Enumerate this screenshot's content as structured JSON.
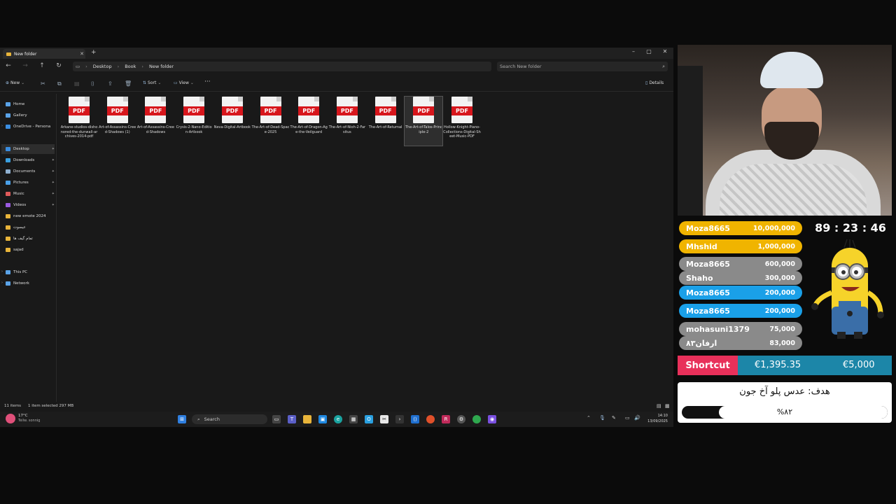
{
  "explorer": {
    "tab_title": "New folder",
    "breadcrumb": [
      "Desktop",
      "Book",
      "New folder"
    ],
    "search_placeholder": "Search New folder",
    "commands": {
      "new": "New",
      "sort": "Sort",
      "view": "View",
      "details": "Details"
    },
    "sidebar": [
      {
        "label": "Home",
        "color": "#5aa3e8"
      },
      {
        "label": "Gallery",
        "color": "#5aa3e8"
      },
      {
        "label": "OneDrive - Persona",
        "color": "#3a8de0"
      },
      {
        "label": "Desktop",
        "color": "#3a8de0",
        "pinned": true,
        "selected": true
      },
      {
        "label": "Downloads",
        "color": "#3aa0e0",
        "pinned": true
      },
      {
        "label": "Documents",
        "color": "#8fb0d0",
        "pinned": true
      },
      {
        "label": "Pictures",
        "color": "#4aa0e8",
        "pinned": true
      },
      {
        "label": "Music",
        "color": "#e05a5a",
        "pinned": true
      },
      {
        "label": "Videos",
        "color": "#9a5ae0",
        "pinned": true
      },
      {
        "label": "new emote 2024",
        "color": "#e8b43a"
      },
      {
        "label": "عیسوت",
        "color": "#e8b43a"
      },
      {
        "label": "تمام گیف ها",
        "color": "#e8b43a"
      },
      {
        "label": "sajad",
        "color": "#e8b43a"
      },
      {
        "label": "This PC",
        "color": "#5aa3e8"
      },
      {
        "label": "Network",
        "color": "#5aa3e8"
      }
    ],
    "files": [
      {
        "name": "Arkane-studios-dishonored-the-dunwall-archives-2014-pdf"
      },
      {
        "name": "Art-of-Assassins-Creed-Shadows (1)"
      },
      {
        "name": "Art-of-Assassins-Creed-Shadows"
      },
      {
        "name": "Crysis-2-Nano-Edition-Artbook"
      },
      {
        "name": "Neva-Digital-Artbook"
      },
      {
        "name": "The-Art-of-Dead-Space-2025"
      },
      {
        "name": "The-Art-of-Dragon-Age-the-Veilguard"
      },
      {
        "name": "The-Art-of-Nioh-2-Farsitus"
      },
      {
        "name": "The-Art-of-Returnal"
      },
      {
        "name": "The-Art-of-Talos-Principle-2",
        "selected": true
      },
      {
        "name": "Hollow-Knight-Piano-Collections-Digital-Sheet-Music-PDF"
      }
    ],
    "file_badge": "PDF",
    "status": {
      "items": "11 items",
      "selection": "1 item selected  297 MB"
    }
  },
  "taskbar": {
    "weather_temp": "17°C",
    "weather_desc": "Teilw. sonnig",
    "search": "Search",
    "time": "14:10",
    "date": "13/09/2025"
  },
  "stream": {
    "timer": "89 : 23 : 46",
    "leaderboard": [
      {
        "name": "Moza8665",
        "amount": "10,000,000",
        "color": "#f0b400"
      },
      {
        "name": "Mhshid",
        "amount": "1,000,000",
        "color": "#f0b400"
      },
      {
        "name": "Moza8665",
        "amount": "600,000",
        "color": "#8a8a8a"
      },
      {
        "name": "Shaho",
        "amount": "300,000",
        "color": "#8a8a8a"
      },
      {
        "name": "Moza8665",
        "amount": "200,000",
        "color": "#1aa0e8"
      },
      {
        "name": "Moza8665",
        "amount": "200,000",
        "color": "#1aa0e8"
      },
      {
        "name": "mohasuni1379",
        "amount": "75,000",
        "color": "#8a8a8a"
      },
      {
        "name": "ارفان۸۳",
        "amount": "83,000",
        "color": "#8a8a8a"
      }
    ],
    "shortcut": {
      "label": "Shortcut",
      "current": "€1,395.35",
      "target": "€5,000"
    },
    "goal": {
      "title": "هدف: عدس پلو آخ جون",
      "percent_label": "%۸۲",
      "progress": 0.82
    }
  }
}
